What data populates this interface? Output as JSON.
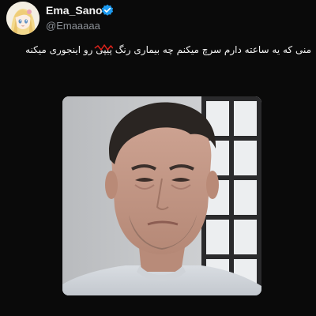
{
  "author": {
    "display_name": "Ema_Sano",
    "handle": "@Emaaaaa",
    "avatar_icon": "anime-girl-avatar",
    "verified_icon": "verified-badge-icon",
    "verified_color": "#1d9bf0"
  },
  "tweet": {
    "text_start": "منی که یه ساعته دارم سرچ میکنم چه بیماری رنگ ",
    "struck_word": "پیپی",
    "text_end": " رو اینجوری میکنه",
    "strike_color": "#e0231c"
  },
  "media": {
    "kind": "photo",
    "subject": "man-portrait-photo"
  },
  "theme": {
    "background": "#0a0a0a",
    "text": "#f4f4f4",
    "muted": "#8b9096"
  }
}
